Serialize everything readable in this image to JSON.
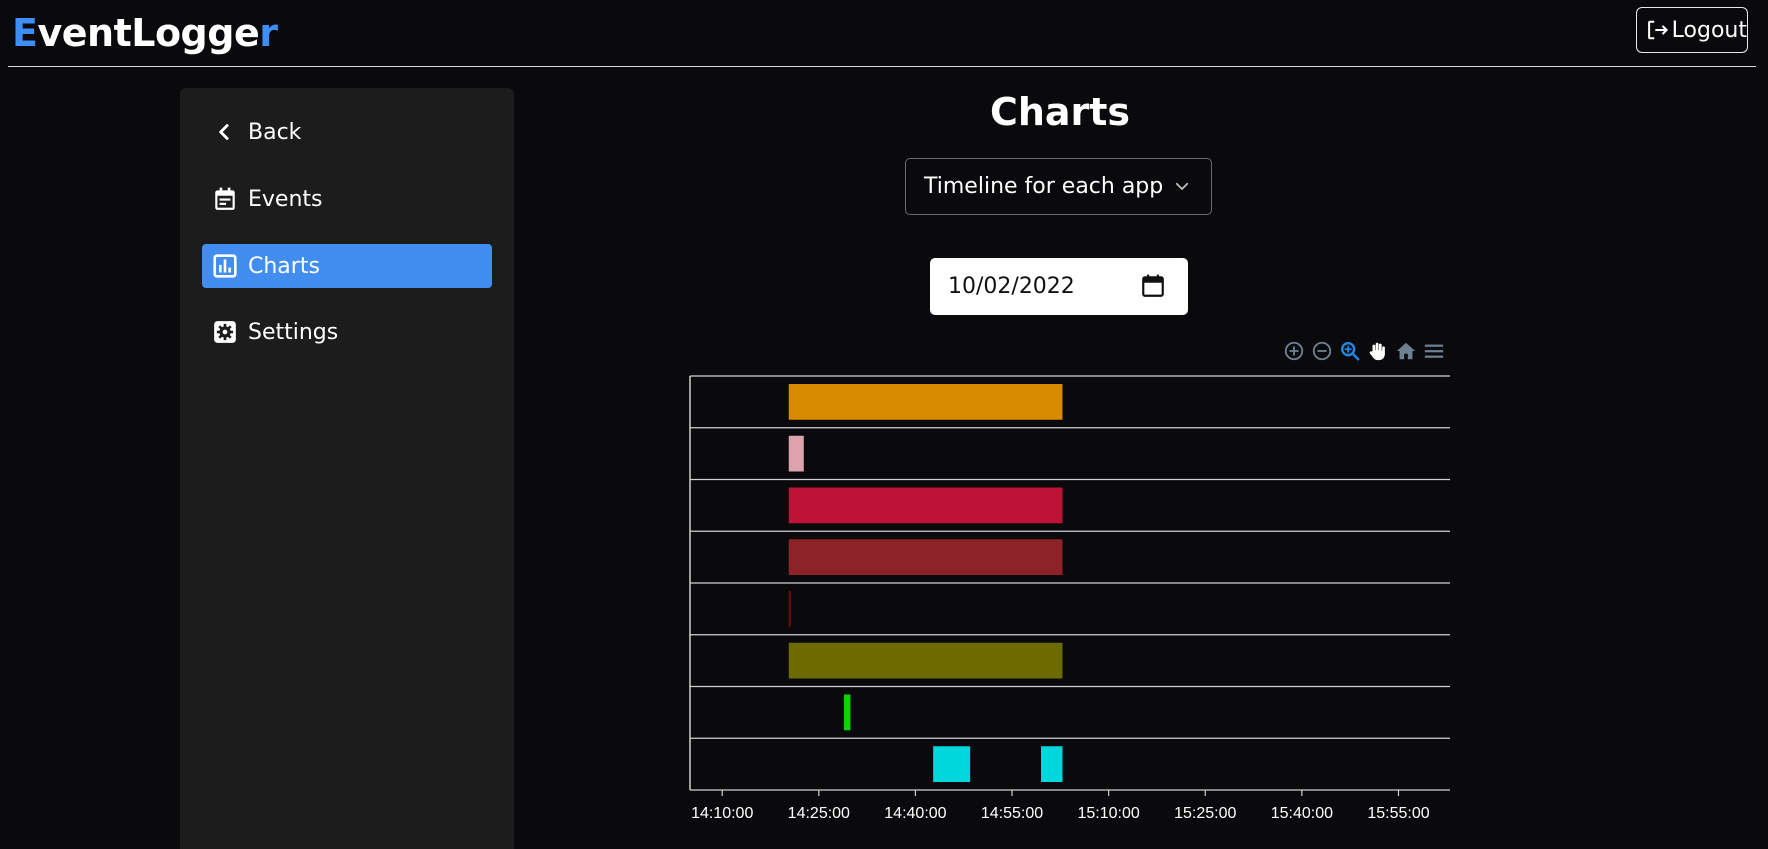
{
  "header": {
    "brand_first": "E",
    "brand_middle": "ventLogge",
    "brand_last": "r",
    "logout_label": "Logout"
  },
  "sidebar": {
    "items": [
      {
        "label": "Back",
        "icon": "chevron-left-icon"
      },
      {
        "label": "Events",
        "icon": "calendar-icon"
      },
      {
        "label": "Charts",
        "icon": "bar-chart-icon",
        "active": true
      },
      {
        "label": "Settings",
        "icon": "gear-icon"
      }
    ]
  },
  "main": {
    "title": "Charts",
    "chart_select_value": "Timeline for each app",
    "date_value": "10/02/2022"
  },
  "toolbar": {
    "icons": [
      "zoom-in-icon",
      "zoom-out-icon",
      "selection-zoom-icon",
      "pan-hand-icon",
      "home-reset-icon",
      "menu-icon"
    ]
  },
  "colors": {
    "accent": "#428ef0",
    "brand_accent": "#3d8ef8",
    "toolbar_active": "#1e88e5",
    "toolbar_inactive": "#6e8192"
  },
  "chart_data": {
    "type": "rangeBar",
    "x_axis": {
      "type": "time",
      "min": "14:05:00",
      "max": "16:03:00",
      "tick_labels": [
        "14:10:00",
        "14:25:00",
        "14:40:00",
        "14:55:00",
        "15:10:00",
        "15:25:00",
        "15:40:00",
        "15:55:00"
      ]
    },
    "rows": 8,
    "grid": true,
    "bars": [
      {
        "row": 0,
        "start": "14:20:20",
        "end": "15:02:50",
        "color": "#d98b00"
      },
      {
        "row": 1,
        "start": "14:20:20",
        "end": "14:22:40",
        "color": "#dca3ad"
      },
      {
        "row": 2,
        "start": "14:20:20",
        "end": "15:02:50",
        "color": "#bf1237"
      },
      {
        "row": 3,
        "start": "14:20:20",
        "end": "15:02:50",
        "color": "#8d2328"
      },
      {
        "row": 4,
        "start": "14:20:20",
        "end": "14:20:35",
        "color": "#6a0f0f"
      },
      {
        "row": 5,
        "start": "14:20:20",
        "end": "15:02:50",
        "color": "#6d6b00"
      },
      {
        "row": 6,
        "start": "14:28:55",
        "end": "14:29:55",
        "color": "#0bd40b"
      },
      {
        "row": 7,
        "start": "14:42:45",
        "end": "14:48:30",
        "color": "#00d7dc"
      },
      {
        "row": 7,
        "start": "14:59:30",
        "end": "15:02:50",
        "color": "#00d7dc"
      }
    ]
  }
}
